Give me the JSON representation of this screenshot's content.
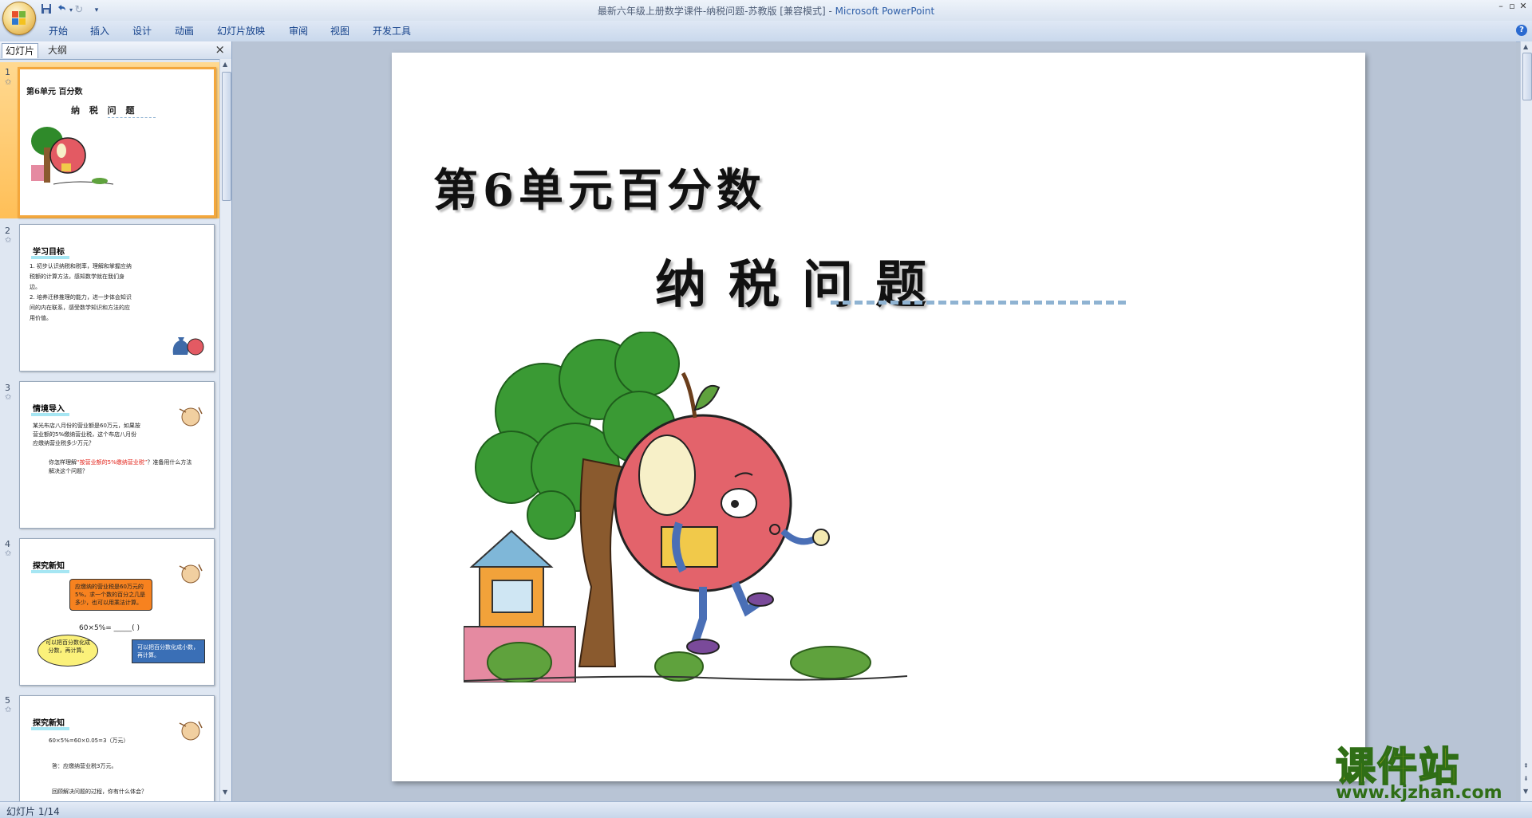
{
  "window": {
    "title_doc": "最新六年级上册数学课件-纳税问题-苏教版 [兼容模式] -",
    "title_app": "Microsoft PowerPoint"
  },
  "quick_access": [
    "save-icon",
    "undo-icon",
    "redo-icon",
    "customize-icon"
  ],
  "ribbon": {
    "tabs": [
      "开始",
      "插入",
      "设计",
      "动画",
      "幻灯片放映",
      "审阅",
      "视图",
      "开发工具"
    ]
  },
  "panel": {
    "tab_slides": "幻灯片",
    "tab_outline": "大纲",
    "close": "×"
  },
  "thumbnails": [
    {
      "num": "1",
      "title": "第6单元 百分数",
      "subtitle": "纳 税 问 题"
    },
    {
      "num": "2",
      "heading": "学习目标",
      "lines": [
        "1. 初步认识纳税和税率，理解和掌握应纳",
        "    税额的计算方法，感知数学就在我们身",
        "    边。",
        "2. 培养迁移推理的能力，进一步体会知识",
        "    间的内在联系，感受数学知识和方法的应",
        "    用价值。"
      ]
    },
    {
      "num": "3",
      "heading": "情境导入",
      "lines": [
        "某光布店八月份的营业额是60万元，如果按",
        "营业额的5%缴纳营业税，这个布店八月份",
        "应缴纳营业税多少万元？"
      ],
      "q1": "你怎样理解",
      "q_red": "“按营业额的5%缴纳营业税”",
      "q2": "？准备用什么方法解决这个问题？"
    },
    {
      "num": "4",
      "heading": "探究新知",
      "bubble1": "应缴纳的营业税是60万元的5%，求一个数的百分之几是多少，也可以用乘法计算。",
      "formula": "60×5%= _____(      )",
      "bubble2": "可以把百分数化成分数，再计算。",
      "bubble3": "可以把百分数化成小数，再计算。"
    },
    {
      "num": "5",
      "heading": "探究新知",
      "line1": "60×5%=60×0.05=3（万元）",
      "line2": "答：应缴纳营业税3万元。",
      "line3": "回顾解决问题的过程，你有什么体会？"
    }
  ],
  "slide": {
    "unit_title": "第6单元百分数",
    "topic_title": "纳税问题"
  },
  "status": {
    "text": "幻灯片 1/14"
  },
  "watermark": {
    "big": "课件站",
    "small": "www.kjzhan.com"
  },
  "colors": {
    "accent": "#f4a73c",
    "dash": "#8fb3d2",
    "heading_bar": "#a6e6f3"
  }
}
